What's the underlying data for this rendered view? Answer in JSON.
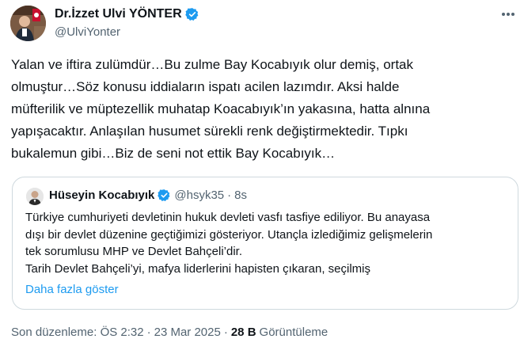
{
  "author": {
    "name": "Dr.İzzet Ulvi YÖNTER",
    "handle": "@UlviYonter",
    "verified_color": "#1d9bf0"
  },
  "tweet": {
    "text": "Yalan ve iftira zulümdür…Bu zulme Bay Kocabıyık olur demiş, ortak\nolmuştur…Söz konusu iddiaların ispatı acilen lazımdır. Aksi halde\nmüfterilik ve müptezellik muhatap Koacabıyık’ın yakasına, hatta alnına\nyapışacaktır. Anlaşılan husumet sürekli renk değiştirmektedir. Tıpkı\nbukalemun gibi…Biz de seni not ettik Bay Kocabıyık…"
  },
  "quote": {
    "name": "Hüseyin Kocabıyık",
    "handle": "@hsyk35",
    "dot": "·",
    "time": "8s",
    "text": "Türkiye cumhuriyeti devletinin hukuk devleti vasfı tasfiye ediliyor. Bu anayasa\ndışı bir devlet düzenine geçtiğimizi gösteriyor. Utançla izlediğimiz gelişmelerin\ntek sorumlusu MHP ve Devlet Bahçeli’dir.\nTarih Devlet Bahçeli’yi, mafya liderlerini hapisten çıkaran, seçilmiş",
    "show_more": "Daha fazla göster"
  },
  "meta": {
    "edited_label": "Son düzenleme: ÖS 2:32",
    "separator": "·",
    "date": "23 Mar 2025",
    "views_count": "28 B",
    "views_label": "Görüntüleme"
  },
  "icons": {
    "verified": "verified-badge-icon",
    "more": "more-options-icon"
  }
}
